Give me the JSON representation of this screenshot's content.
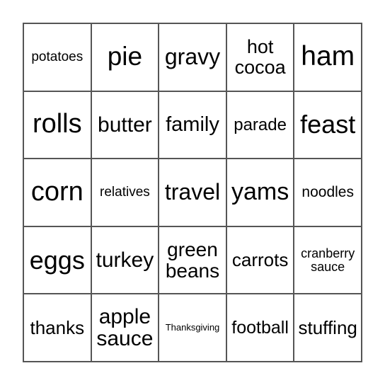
{
  "card": {
    "cells": [
      {
        "text": "potatoes",
        "size": 19
      },
      {
        "text": "pie",
        "size": 37
      },
      {
        "text": "gravy",
        "size": 32
      },
      {
        "text": "hot\ncocoa",
        "size": 27
      },
      {
        "text": "ham",
        "size": 39
      },
      {
        "text": "rolls",
        "size": 38
      },
      {
        "text": "butter",
        "size": 30
      },
      {
        "text": "family",
        "size": 29
      },
      {
        "text": "parade",
        "size": 24
      },
      {
        "text": "feast",
        "size": 36
      },
      {
        "text": "corn",
        "size": 38
      },
      {
        "text": "relatives",
        "size": 19
      },
      {
        "text": "travel",
        "size": 32
      },
      {
        "text": "yams",
        "size": 34
      },
      {
        "text": "noodles",
        "size": 21
      },
      {
        "text": "eggs",
        "size": 36
      },
      {
        "text": "turkey",
        "size": 30
      },
      {
        "text": "green\nbeans",
        "size": 28
      },
      {
        "text": "carrots",
        "size": 26
      },
      {
        "text": "cranberry\nsauce",
        "size": 18
      },
      {
        "text": "thanks",
        "size": 26
      },
      {
        "text": "apple\nsauce",
        "size": 30
      },
      {
        "text": "Thanksgiving",
        "size": 13
      },
      {
        "text": "football",
        "size": 25
      },
      {
        "text": "stuffing",
        "size": 26
      }
    ]
  },
  "colors": {
    "grid_line": "#555555",
    "text": "#000000",
    "background": "#ffffff"
  }
}
